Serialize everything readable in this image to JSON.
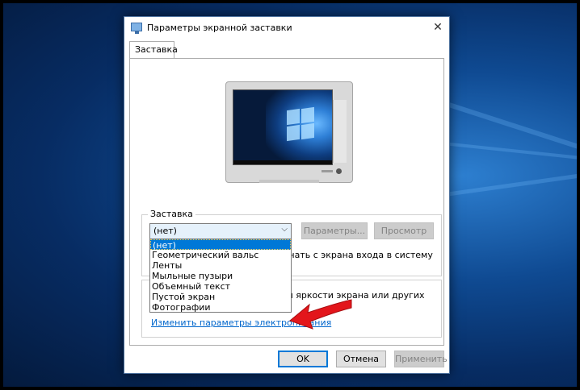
{
  "dialog": {
    "title": "Параметры экранной заставки"
  },
  "tabs": [
    {
      "label": "Заставка"
    }
  ],
  "screensaver": {
    "group_label": "Заставка",
    "selected": "(нет)",
    "options": [
      "(нет)",
      "Геометрический вальс",
      "Ленты",
      "Мыльные пузыри",
      "Объемный текст",
      "Пустой экран",
      "Фотографии"
    ],
    "settings_label": "Параметры...",
    "preview_label": "Просмотр",
    "logon_text": "ачинать с экрана входа в систему"
  },
  "power": {
    "text": "ия яркости экрана или других",
    "link": "Изменить параметры электропитания"
  },
  "buttons": {
    "ok": "OK",
    "cancel": "Отмена",
    "apply": "Применить"
  },
  "icons": {
    "close": "close-icon",
    "window": "display-settings-icon",
    "annotation": "red-arrow-icon"
  },
  "colors": {
    "accent": "#0078d7",
    "link": "#0066cc",
    "annotation_arrow": "#e3161b"
  }
}
